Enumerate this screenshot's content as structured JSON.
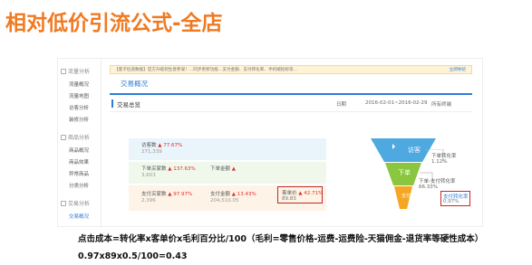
{
  "title": "相对低价引流公式-全店",
  "sidebar": {
    "sections": [
      {
        "label": "流量分析",
        "items": [
          "流量概况",
          "流量地图",
          "访客分析",
          "装修分析"
        ]
      },
      {
        "label": "商品分析",
        "items": [
          "商品概况",
          "商品效果",
          "异常商品",
          "分类分析"
        ]
      },
      {
        "label": "交易分析",
        "items": [
          "交易概况"
        ]
      }
    ]
  },
  "notice": {
    "text": "【量子恒道数据】官方升级到生意参谋！…同步更新功能…支付金额、支付转化率、手机端指标等…",
    "link": "立即体验"
  },
  "tab": {
    "label": "交易概况"
  },
  "sub": {
    "label": "交易总览",
    "granularity": "日期",
    "date_range": "2016-02-01~2016-02-29",
    "terminal": "所有终端"
  },
  "rows": [
    {
      "metric": "访客数",
      "pct": "77.67%",
      "value": "271,339"
    },
    {
      "metric": "下单买家数",
      "pct": "137.63%",
      "value": "3,603",
      "metric2": "下单金额",
      "pct2": "",
      "value2": ""
    },
    {
      "metric": "支付买家数",
      "pct": "97.97%",
      "value": "2,396",
      "metric2": "支付金额",
      "pct2": "13.43%",
      "value2": "204,510.05",
      "metric3": "客单价",
      "pct3": "42.71%",
      "value3": "89.83"
    }
  ],
  "funnel": {
    "stages": [
      "访客",
      "下单",
      "支付"
    ],
    "labels": [
      {
        "title": "下单转化率",
        "value": "1.12%"
      },
      {
        "title": "下单-支付转化率",
        "value": "66.33%"
      },
      {
        "title": "支付转化率",
        "value": "0.97%"
      }
    ],
    "colors": {
      "blue": "#4ea9e0",
      "green": "#8ac63f",
      "orange": "#f5a623"
    }
  },
  "footer": {
    "line1": "点击成本=转化率x客单价x毛利百分比/100（毛利=零售价格-运费-运费险-天猫佣金-退货率等硬性成本）",
    "line2": "0.97x89x0.5/100=0.43"
  }
}
